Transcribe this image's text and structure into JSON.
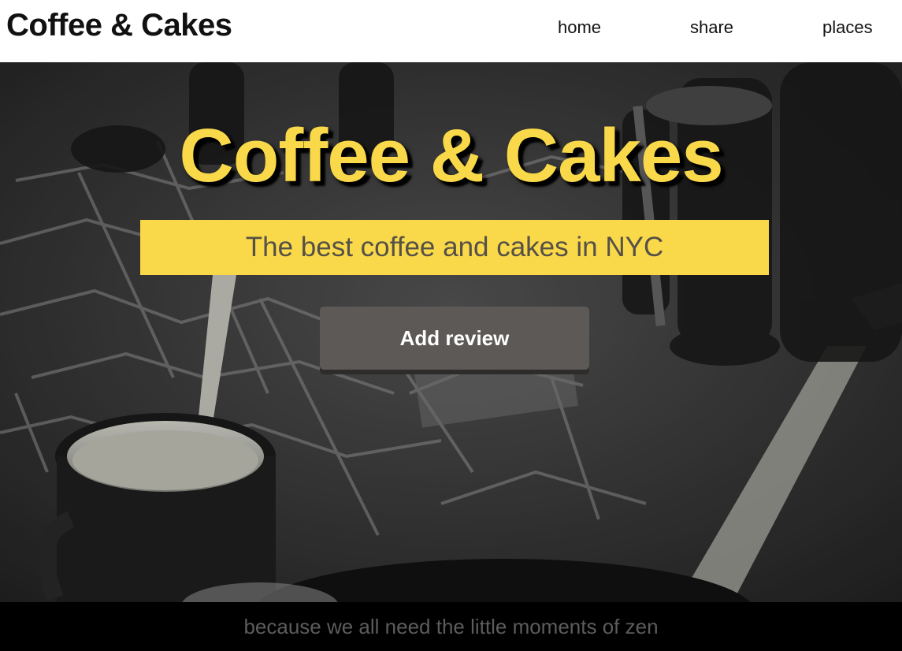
{
  "navbar": {
    "brand": "Coffee & Cakes",
    "links": [
      {
        "label": "home"
      },
      {
        "label": "share"
      },
      {
        "label": "places"
      }
    ]
  },
  "hero": {
    "title": "Coffee & Cakes",
    "tagline": "The best coffee and cakes in NYC",
    "button_label": "Add review",
    "background_image": "grayscale photo of coffee cup on tiled sidewalk with people walking"
  },
  "footer": {
    "text": "because we all need the little moments of zen"
  },
  "colors": {
    "accent_yellow": "#f9d949",
    "button_gray": "#5d5957",
    "footer_text": "#5c5c5c"
  }
}
